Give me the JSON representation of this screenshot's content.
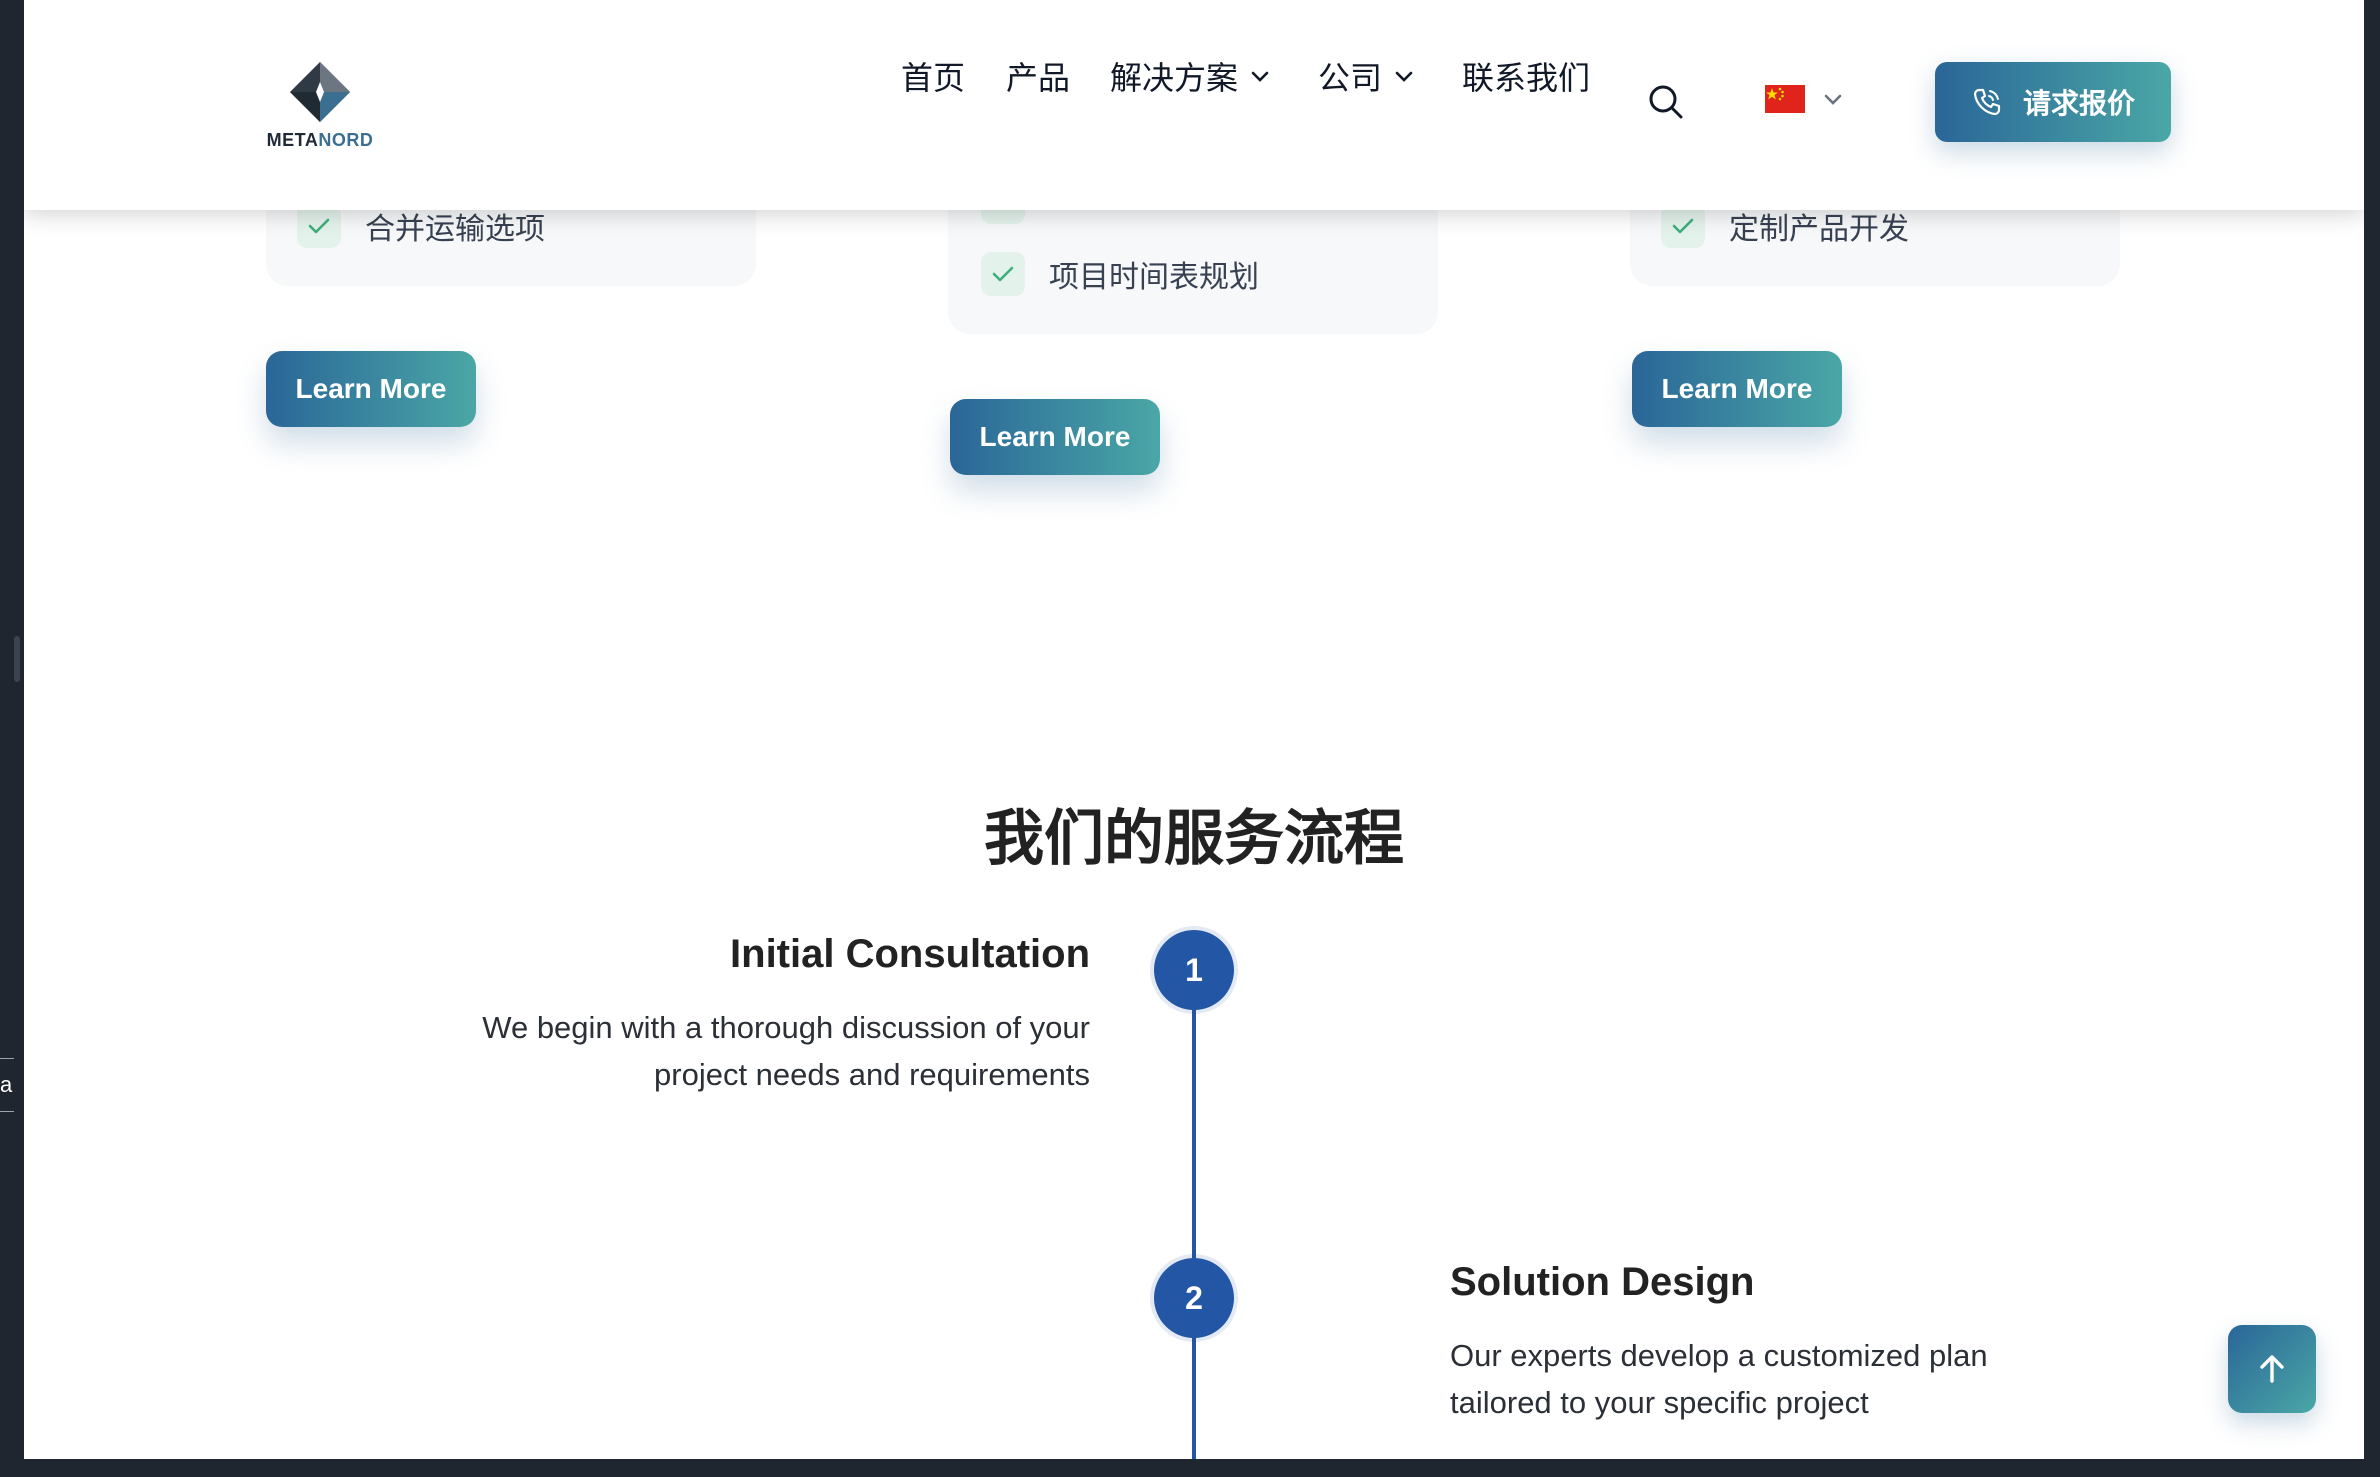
{
  "edge_tab": {
    "text": "a"
  },
  "header": {
    "logo_text_main": "META",
    "logo_text_accent": "NORD",
    "nav": [
      {
        "label": "首页"
      },
      {
        "label": "产品"
      },
      {
        "label": "解决方案"
      },
      {
        "label": "公司"
      },
      {
        "label": "联系我们"
      }
    ],
    "quote_button": "请求报价"
  },
  "cards": [
    {
      "items": [
        "合并运输选项"
      ],
      "button": "Learn More"
    },
    {
      "items": [
        "项目时间表规划"
      ],
      "button": "Learn More"
    },
    {
      "items": [
        "定制产品开发"
      ],
      "button": "Learn More"
    }
  ],
  "process": {
    "title": "我们的服务流程",
    "steps": [
      {
        "number": "1",
        "title": "Initial Consultation",
        "desc_lines": [
          "We begin with a thorough discussion of your",
          "project needs and requirements"
        ]
      },
      {
        "number": "2",
        "title": "Solution Design",
        "desc_lines": [
          "Our experts develop a customized plan",
          "tailored to your specific project"
        ]
      }
    ]
  },
  "colors": {
    "accent_blue": "#2456a6",
    "gradient_start": "#2a6698",
    "gradient_end": "#4aa7a6",
    "check_green": "#3fae7a"
  },
  "icons": {
    "search": "search-icon",
    "phone": "phone-icon",
    "top": "arrow-up-icon",
    "check": "check-icon"
  }
}
